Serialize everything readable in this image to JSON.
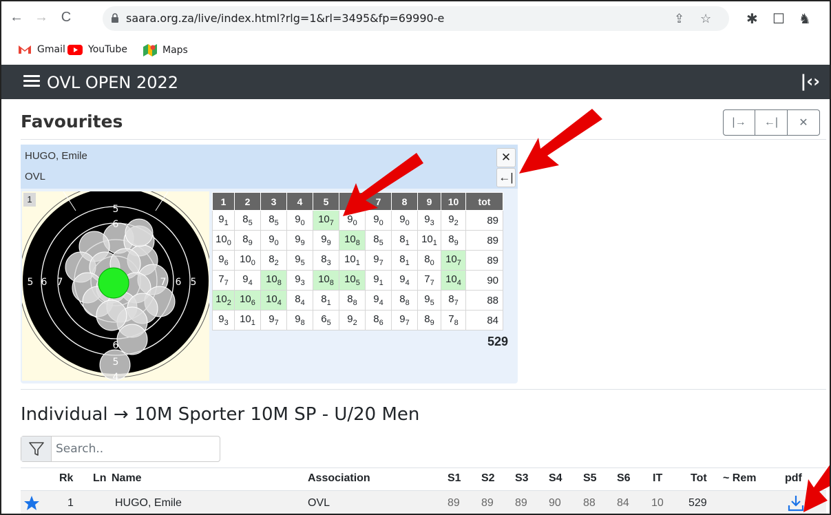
{
  "browser": {
    "url": "saara.org.za/live/index.html?rlg=1&rl=3495&fp=69990-e",
    "bookmarks": [
      "Gmail",
      "YouTube",
      "Maps"
    ]
  },
  "app": {
    "title": "OVL OPEN 2022"
  },
  "favourites": {
    "title": "Favourites",
    "athlete_name": "HUGO, Emile",
    "athlete_club": "OVL",
    "series_number": "1",
    "target_numbers": [
      "5",
      "6",
      "5",
      "6",
      "7",
      "7",
      "6",
      "5",
      "6",
      "5",
      "4"
    ],
    "headers": [
      "1",
      "2",
      "3",
      "4",
      "5",
      "6",
      "7",
      "8",
      "9",
      "10",
      "tot"
    ],
    "rows": [
      {
        "shots": [
          [
            "9",
            "1"
          ],
          [
            "8",
            "5"
          ],
          [
            "8",
            "5"
          ],
          [
            "9",
            "0"
          ],
          [
            "10",
            "7"
          ],
          [
            "9",
            "0"
          ],
          [
            "9",
            "0"
          ],
          [
            "9",
            "0"
          ],
          [
            "9",
            "3"
          ],
          [
            "9",
            "2"
          ]
        ],
        "hl": [
          4
        ],
        "tot": "89"
      },
      {
        "shots": [
          [
            "10",
            "0"
          ],
          [
            "8",
            "9"
          ],
          [
            "9",
            "0"
          ],
          [
            "9",
            "9"
          ],
          [
            "9",
            "9"
          ],
          [
            "10",
            "8"
          ],
          [
            "8",
            "5"
          ],
          [
            "8",
            "1"
          ],
          [
            "10",
            "1"
          ],
          [
            "8",
            "9"
          ]
        ],
        "hl": [
          5
        ],
        "tot": "89"
      },
      {
        "shots": [
          [
            "9",
            "6"
          ],
          [
            "10",
            "0"
          ],
          [
            "8",
            "2"
          ],
          [
            "9",
            "5"
          ],
          [
            "8",
            "3"
          ],
          [
            "10",
            "1"
          ],
          [
            "9",
            "7"
          ],
          [
            "8",
            "1"
          ],
          [
            "8",
            "0"
          ],
          [
            "10",
            "7"
          ]
        ],
        "hl": [
          9
        ],
        "tot": "89"
      },
      {
        "shots": [
          [
            "7",
            "7"
          ],
          [
            "9",
            "4"
          ],
          [
            "10",
            "8"
          ],
          [
            "9",
            "3"
          ],
          [
            "10",
            "8"
          ],
          [
            "10",
            "5"
          ],
          [
            "9",
            "1"
          ],
          [
            "9",
            "4"
          ],
          [
            "7",
            "7"
          ],
          [
            "10",
            "4"
          ]
        ],
        "hl": [
          2,
          4,
          5,
          9
        ],
        "tot": "90"
      },
      {
        "shots": [
          [
            "10",
            "2"
          ],
          [
            "10",
            "6"
          ],
          [
            "10",
            "4"
          ],
          [
            "8",
            "4"
          ],
          [
            "8",
            "1"
          ],
          [
            "8",
            "8"
          ],
          [
            "9",
            "4"
          ],
          [
            "8",
            "8"
          ],
          [
            "9",
            "5"
          ],
          [
            "8",
            "7"
          ]
        ],
        "hl": [
          0,
          1,
          2
        ],
        "tot": "88"
      },
      {
        "shots": [
          [
            "9",
            "3"
          ],
          [
            "10",
            "1"
          ],
          [
            "9",
            "7"
          ],
          [
            "9",
            "8"
          ],
          [
            "6",
            "5"
          ],
          [
            "9",
            "2"
          ],
          [
            "8",
            "6"
          ],
          [
            "9",
            "7"
          ],
          [
            "8",
            "9"
          ],
          [
            "7",
            "8"
          ]
        ],
        "hl": [],
        "tot": "84"
      }
    ],
    "grand_total": "529"
  },
  "individual": {
    "title": "Individual  →  10M Sporter 10M SP - U/20 Men",
    "search_placeholder": "Search..",
    "columns": {
      "rk": "Rk",
      "ln": "Ln",
      "name": "Name",
      "assoc": "Association",
      "s1": "S1",
      "s2": "S2",
      "s3": "S3",
      "s4": "S4",
      "s5": "S5",
      "s6": "S6",
      "it": "IT",
      "tot": "Tot",
      "rem": "~ Rem",
      "pdf": "pdf"
    },
    "rows": [
      {
        "rk": "1",
        "name": "HUGO, Emile",
        "assoc": "OVL",
        "s1": "89",
        "s2": "89",
        "s3": "89",
        "s4": "90",
        "s5": "88",
        "s6": "84",
        "it": "10",
        "tot": "529"
      }
    ]
  },
  "colors": {
    "accent": "#1a73e8",
    "highlight": "#ccf5cc",
    "navbar": "#343a40",
    "annotation": "#e60000"
  }
}
